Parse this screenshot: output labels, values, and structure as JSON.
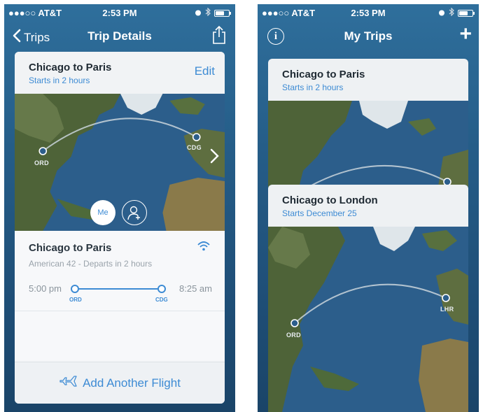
{
  "left": {
    "status": {
      "carrier": "●●●○○ AT&T",
      "time": "2:53 PM",
      "battery_level": 0.6
    },
    "nav": {
      "back_label": "Trips",
      "title": "Trip Details"
    },
    "trip": {
      "title": "Chicago to Paris",
      "subtitle": "Starts in 2 hours",
      "edit_label": "Edit"
    },
    "map": {
      "origin_code": "ORD",
      "dest_code": "CDG"
    },
    "travelers": {
      "me_label": "Me"
    },
    "flight": {
      "title": "Chicago to Paris",
      "subtitle": "American 42 - Departs in 2 hours",
      "depart_time": "5:00 pm",
      "arrive_time": "8:25 am",
      "origin_code": "ORD",
      "dest_code": "CDG"
    },
    "add_flight_label": "Add Another Flight"
  },
  "right": {
    "status": {
      "carrier": "●●●○○ AT&T",
      "time": "2:53 PM",
      "battery_level": 0.6
    },
    "nav": {
      "title": "My Trips",
      "add_label": "+"
    },
    "trips": [
      {
        "title": "Chicago to Paris",
        "subtitle": "Starts in 2 hours"
      },
      {
        "title": "Chicago to London",
        "subtitle": "Starts December 25",
        "origin_code": "ORD",
        "dest_code": "LHR"
      }
    ]
  },
  "colors": {
    "accent": "#3d8bd4",
    "ocean": "#2d5f8c",
    "land": "#5a6a3c"
  },
  "icons": [
    "back-chevron-icon",
    "share-icon",
    "wifi-icon",
    "airplane-icon",
    "info-icon",
    "plus-icon",
    "add-person-icon",
    "alarm-icon",
    "bluetooth-icon",
    "battery-icon"
  ]
}
